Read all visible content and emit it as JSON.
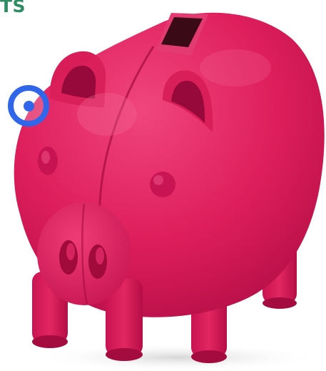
{
  "page": {
    "corner_text": "TS"
  },
  "photo": {
    "subject_icon": "piggy-bank-icon",
    "colors": {
      "body": "#e0205f",
      "shadow": "#b80f47",
      "highlight": "#f14b82",
      "slot": "#3a0a16"
    }
  },
  "cursor": {
    "icon": "cursor-target-icon",
    "color": "#2f66ea"
  }
}
